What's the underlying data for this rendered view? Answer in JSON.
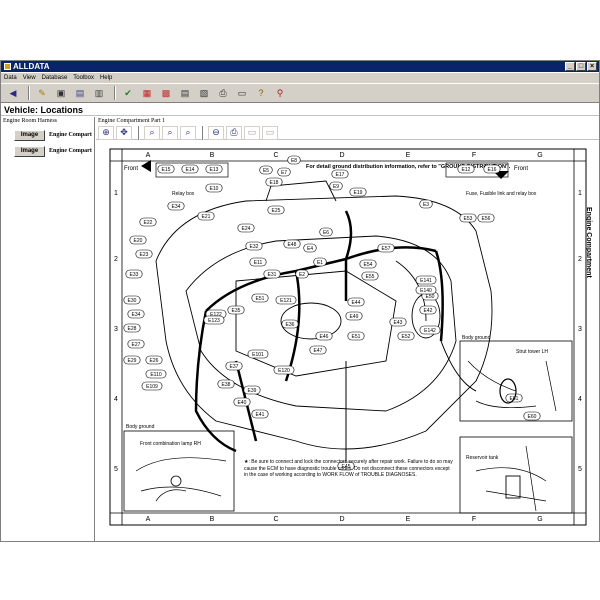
{
  "window": {
    "title": "ALLDATA"
  },
  "menu": {
    "items": [
      "Data",
      "View",
      "Database",
      "Toolbox",
      "Help"
    ]
  },
  "toolbar": {
    "icons": [
      "back-arrow-icon",
      "notes-icon",
      "car-icon",
      "car-select-icon",
      "list-icon",
      "check-icon",
      "data-icon",
      "component-icon",
      "table-icon",
      "print-icon",
      "print-setup-icon",
      "help-icon",
      "search-icon"
    ]
  },
  "header": {
    "title": "Vehicle:  Locations"
  },
  "left": {
    "heading": "Engine Room Harness",
    "rows": [
      {
        "button": "Image",
        "label": "Engine Compart"
      },
      {
        "button": "Image",
        "label": "Engine Compart"
      }
    ]
  },
  "right": {
    "heading": "Engine Compartment Part 1",
    "view_tools": [
      "zoom-in-icon",
      "move-icon",
      "zoom-fit-icon",
      "zoom-plus-icon",
      "zoom-minus-icon",
      "zoom-out-icon",
      "print-icon",
      "disabled-icon-a",
      "disabled-icon-b"
    ]
  },
  "diagram": {
    "side_title": "Engine Compartment",
    "columns": [
      "A",
      "B",
      "C",
      "D",
      "E",
      "F",
      "G"
    ],
    "rows": [
      "1",
      "2",
      "3",
      "4",
      "5"
    ],
    "front_left": "Front",
    "front_right": "Front",
    "note_top": "For detail ground distribution information, refer to \"GROUND DISTRIBUTION\".",
    "relay_box": "Relay box",
    "fuse_box": "Fuse, Fusible link and relay box",
    "body_ground_left": "Body ground",
    "body_ground_right": "Body ground",
    "strut_tower": "Strut tower LH",
    "front_combination": "Front combination lamp RH",
    "reservoir_tank": "Reservoir tank",
    "warning": "★: Be sure to connect and lock the connectors securely after repair work. Failure to do so may cause the ECM to have diagnostic trouble codes. Do not disconnect these connectors except in the case of working according to WORK FLOW of TROUBLE DIAGNOSES.",
    "connectors": [
      "E15",
      "E14",
      "E13",
      "E8",
      "E7",
      "E5",
      "E17",
      "E9",
      "E18",
      "E19",
      "E10",
      "E34",
      "E22",
      "E21",
      "E20",
      "E23",
      "E33",
      "E32",
      "E11",
      "E31",
      "E2",
      "E1",
      "E4",
      "E6",
      "E3",
      "E53",
      "E56",
      "E57",
      "E54",
      "E55",
      "E141",
      "E50",
      "E42",
      "E43",
      "E44",
      "E49",
      "E51",
      "E121",
      "E35",
      "E36",
      "E122",
      "E123",
      "E30",
      "E34",
      "E28",
      "E27",
      "E29",
      "E26",
      "E101",
      "E120",
      "E37",
      "E38",
      "E39",
      "E40",
      "E41",
      "E45",
      "E12",
      "E16",
      "E60",
      "E61",
      "E51",
      "E52",
      "E46",
      "E47",
      "E48",
      "E25",
      "E24",
      "E140",
      "E142",
      "E110",
      "E109"
    ]
  }
}
